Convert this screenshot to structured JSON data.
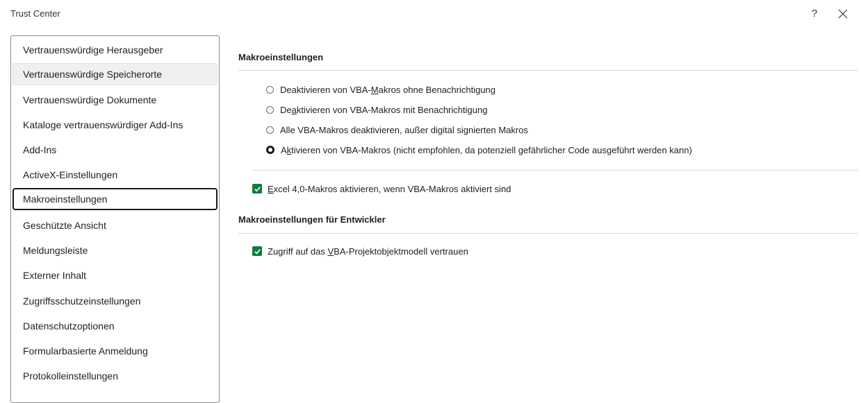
{
  "window": {
    "title": "Trust Center",
    "help_label": "?"
  },
  "sidebar": {
    "items": [
      {
        "label": "Vertrauenswürdige Herausgeber"
      },
      {
        "label": "Vertrauenswürdige Speicherorte"
      },
      {
        "label": "Vertrauenswürdige Dokumente"
      },
      {
        "label": "Kataloge vertrauenswürdiger Add-Ins"
      },
      {
        "label": "Add-Ins"
      },
      {
        "label": "ActiveX-Einstellungen"
      },
      {
        "label": "Makroeinstellungen"
      },
      {
        "label": "Geschützte Ansicht"
      },
      {
        "label": "Meldungsleiste"
      },
      {
        "label": "Externer Inhalt"
      },
      {
        "label": "Zugriffsschutzeinstellungen"
      },
      {
        "label": "Datenschutzoptionen"
      },
      {
        "label": "Formularbasierte Anmeldung"
      },
      {
        "label": "Protokolleinstellungen"
      }
    ],
    "selected": "Makroeinstellungen",
    "hovered": "Vertrauenswürdige Speicherorte"
  },
  "macro_settings": {
    "heading": "Makroeinstellungen",
    "options": [
      {
        "pre": "Deaktivieren von VBA-",
        "accel": "M",
        "post": "akros ohne Benachrichtigung",
        "checked": false
      },
      {
        "pre": "De",
        "accel": "a",
        "post": "ktivieren von VBA-Makros mit Benachrichtigung",
        "checked": false
      },
      {
        "pre": "Alle VBA-Makros deaktivieren, außer di",
        "accel": "g",
        "post": "ital signierten Makros",
        "checked": false
      },
      {
        "pre": "A",
        "accel": "k",
        "post": "tivieren von VBA-Makros (nicht empfohlen, da potenziell gefährlicher Code ausgeführt werden kann)",
        "checked": true
      }
    ],
    "excel4": {
      "pre": "",
      "accel": "E",
      "post": "xcel 4,0-Makros aktivieren, wenn VBA-Makros aktiviert sind",
      "checked": true
    }
  },
  "developer_settings": {
    "heading": "Makroeinstellungen für Entwickler",
    "trust_vba": {
      "pre": "Zugriff auf das ",
      "accel": "V",
      "post": "BA-Projektobjektmodell vertrauen",
      "checked": true
    }
  },
  "colors": {
    "checkbox_fill": "#107c41",
    "selected_border": "#1a1a1a",
    "hover_fill": "#f0f0f0"
  }
}
